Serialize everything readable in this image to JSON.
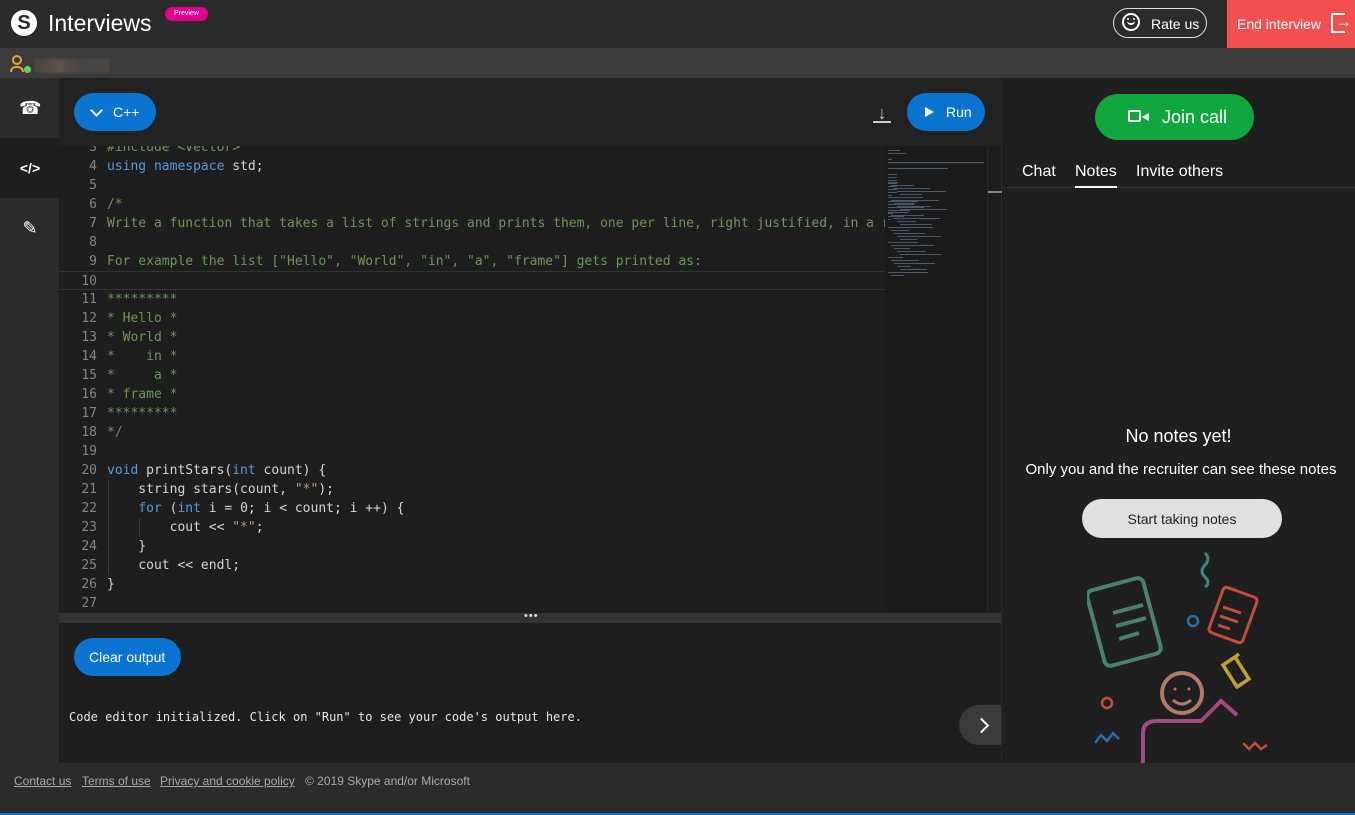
{
  "header": {
    "logo_letter": "S",
    "title": "Interviews",
    "preview_badge": "Preview",
    "rate_label": "Rate us",
    "end_label": "End interview"
  },
  "leftnav": {
    "items": [
      {
        "name": "call",
        "icon": "phone-icon",
        "glyph": "☎",
        "active": false
      },
      {
        "name": "code",
        "icon": "code-icon",
        "glyph": "</>",
        "active": true
      },
      {
        "name": "whiteboard",
        "icon": "pencil-icon",
        "glyph": "✎",
        "active": false
      }
    ]
  },
  "editor": {
    "language": "C++",
    "run_label": "Run",
    "lines": [
      {
        "n": "3",
        "parts": [
          [
            "cm",
            "#include <vector>"
          ]
        ]
      },
      {
        "n": "4",
        "parts": [
          [
            "kw",
            "using"
          ],
          [
            "pl",
            " "
          ],
          [
            "kw",
            "namespace"
          ],
          [
            "pl",
            " std;"
          ]
        ]
      },
      {
        "n": "5",
        "parts": []
      },
      {
        "n": "6",
        "parts": [
          [
            "cm",
            "/*"
          ]
        ]
      },
      {
        "n": "7",
        "parts": [
          [
            "cm",
            "Write a function that takes a list of strings and prints them, one per line, right justified, in a re"
          ]
        ]
      },
      {
        "n": "8",
        "parts": []
      },
      {
        "n": "9",
        "parts": [
          [
            "cm",
            "For example the list [\"Hello\", \"World\", \"in\", \"a\", \"frame\"] gets printed as:"
          ]
        ]
      },
      {
        "n": "10",
        "parts": []
      },
      {
        "n": "11",
        "parts": [
          [
            "cm",
            "*********"
          ]
        ]
      },
      {
        "n": "12",
        "parts": [
          [
            "cm",
            "* Hello *"
          ]
        ]
      },
      {
        "n": "13",
        "parts": [
          [
            "cm",
            "* World *"
          ]
        ]
      },
      {
        "n": "14",
        "parts": [
          [
            "cm",
            "*    in *"
          ]
        ]
      },
      {
        "n": "15",
        "parts": [
          [
            "cm",
            "*     a *"
          ]
        ]
      },
      {
        "n": "16",
        "parts": [
          [
            "cm",
            "* frame *"
          ]
        ]
      },
      {
        "n": "17",
        "parts": [
          [
            "cm",
            "*********"
          ]
        ]
      },
      {
        "n": "18",
        "parts": [
          [
            "cm",
            "*/"
          ]
        ]
      },
      {
        "n": "19",
        "parts": []
      },
      {
        "n": "20",
        "parts": [
          [
            "kw",
            "void"
          ],
          [
            "pl",
            " printStars("
          ],
          [
            "kw",
            "int"
          ],
          [
            "pl",
            " count) {"
          ]
        ]
      },
      {
        "n": "21",
        "parts": [
          [
            "pl",
            "    string stars(count, "
          ],
          [
            "st",
            "\"*\""
          ],
          [
            "pl",
            ");"
          ]
        ]
      },
      {
        "n": "22",
        "parts": [
          [
            "pl",
            "    "
          ],
          [
            "kw",
            "for"
          ],
          [
            "pl",
            " ("
          ],
          [
            "kw",
            "int"
          ],
          [
            "pl",
            " i = 0; i < count; i ++) {"
          ]
        ]
      },
      {
        "n": "23",
        "parts": [
          [
            "pl",
            "        cout << "
          ],
          [
            "st",
            "\"*\""
          ],
          [
            "pl",
            ";"
          ]
        ]
      },
      {
        "n": "24",
        "parts": [
          [
            "pl",
            "    }"
          ]
        ]
      },
      {
        "n": "25",
        "parts": [
          [
            "pl",
            "    cout << endl;"
          ]
        ]
      },
      {
        "n": "26",
        "parts": [
          [
            "pl",
            "}"
          ]
        ]
      },
      {
        "n": "27",
        "parts": []
      }
    ]
  },
  "output": {
    "clear_label": "Clear output",
    "text": "Code editor initialized. Click on \"Run\" to see your code's output here."
  },
  "rightpanel": {
    "join_label": "Join call",
    "tabs": [
      {
        "label": "Chat",
        "active": false
      },
      {
        "label": "Notes",
        "active": true
      },
      {
        "label": "Invite others",
        "active": false
      }
    ],
    "empty_title": "No notes yet!",
    "empty_subtitle": "Only you and the recruiter can see these notes",
    "start_label": "Start taking notes"
  },
  "footer": {
    "links": [
      "Contact us",
      "Terms of use",
      "Privacy and cookie policy"
    ],
    "copyright": "© 2019 Skype and/or Microsoft"
  },
  "colors": {
    "accent_blue": "#0b74d0",
    "end_red": "#f25050",
    "join_green": "#10a83e",
    "preview_pink": "#e3008c"
  }
}
